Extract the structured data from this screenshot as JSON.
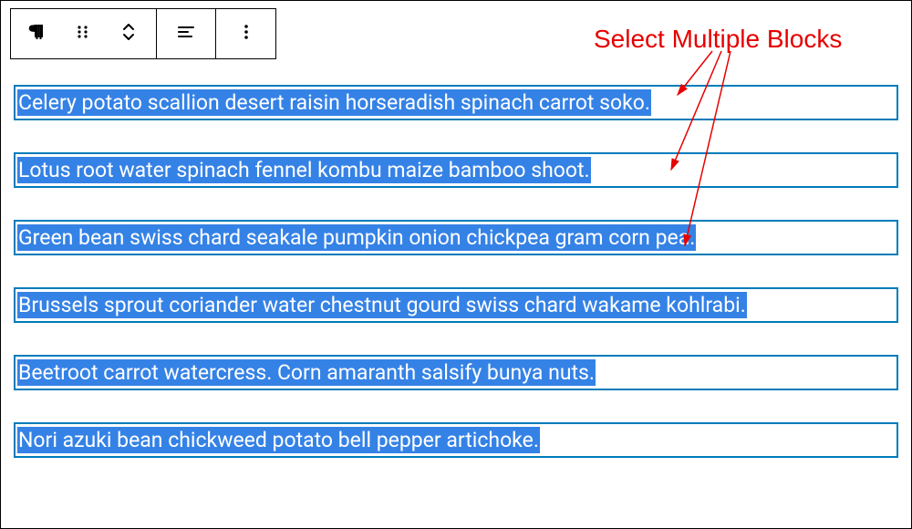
{
  "toolbar": {
    "block_type": "paragraph-icon",
    "drag": "drag-handle-icon",
    "move": "move-up-down-icon",
    "align": "align-left-icon",
    "more": "more-options-icon"
  },
  "annotation": {
    "label": "Select Multiple Blocks"
  },
  "blocks": [
    {
      "text": "Celery potato scallion desert raisin horseradish spinach carrot soko."
    },
    {
      "text": "Lotus root water spinach fennel kombu maize bamboo shoot."
    },
    {
      "text": "Green bean swiss chard seakale pumpkin onion chickpea gram corn pea."
    },
    {
      "text": "Brussels sprout coriander water chestnut gourd swiss chard wakame kohlrabi."
    },
    {
      "text": "Beetroot carrot watercress. Corn amaranth salsify bunya nuts."
    },
    {
      "text": "Nori azuki bean chickweed potato bell pepper artichoke."
    }
  ],
  "colors": {
    "selection_bg": "#3582e6",
    "block_border": "#007cba",
    "annotation": "#e60000"
  }
}
